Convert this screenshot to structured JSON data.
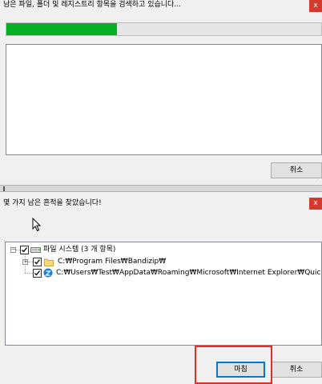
{
  "scan_dialog": {
    "title": "남은 파일, 폴더 및 레지스트리 항목을 검색하고 있습니다...",
    "close_glyph": "x",
    "progress": 0.35,
    "cancel_label": "취소"
  },
  "result_dialog": {
    "title": "몇 가지 남은 흔적을 찾았습니다!",
    "close_glyph": "x",
    "tree": {
      "root": {
        "label": "파일 시스템 (3 개 항목)",
        "checked": true,
        "icon": "drive-icon"
      },
      "items": [
        {
          "label": "C:₩Program Files₩Bandizip₩",
          "checked": true,
          "icon": "folder-icon"
        },
        {
          "label": "C:₩Users₩Test₩AppData₩Roaming₩Microsoft₩Internet Explorer₩Quick",
          "checked": true,
          "icon": "ie-icon"
        }
      ]
    },
    "finish_label": "마침",
    "cancel_label": "취소"
  },
  "colors": {
    "progress_fill": "#06b025",
    "close_button": "#d33a2c",
    "highlight": "#e03028"
  }
}
